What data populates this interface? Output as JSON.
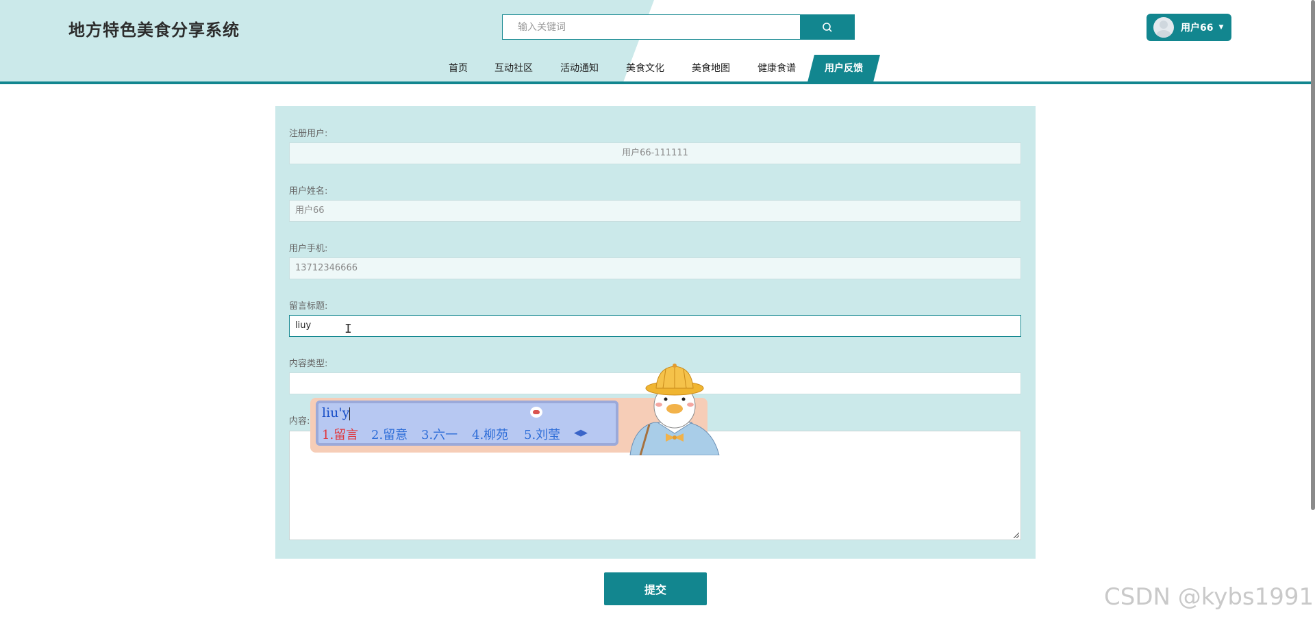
{
  "header": {
    "site_title": "地方特色美食分享系统",
    "search_placeholder": "输入关键词",
    "user_label": "用户66"
  },
  "nav": {
    "items": [
      "首页",
      "互动社区",
      "活动通知",
      "美食文化",
      "美食地图",
      "健康食谱",
      "用户反馈"
    ],
    "active_index": 6
  },
  "form": {
    "registered_user_label": "注册用户:",
    "registered_user_value": "用户66-111111",
    "user_name_label": "用户姓名:",
    "user_name_value": "用户66",
    "user_phone_label": "用户手机:",
    "user_phone_value": "13712346666",
    "message_title_label": "留言标题:",
    "message_title_value": "liuy",
    "content_type_label": "内容类型:",
    "content_type_value": "",
    "content_label": "内容:",
    "submit_label": "提交"
  },
  "ime": {
    "composition": "liu'y",
    "candidates": [
      "1.留言",
      "2.留意",
      "3.六一",
      "4.柳苑",
      "5.刘莹"
    ]
  },
  "watermark": "CSDN @kybs1991",
  "colors": {
    "accent": "#12868f",
    "header_bg": "#cbe9ea",
    "panel_bg": "#cbe9ea"
  }
}
